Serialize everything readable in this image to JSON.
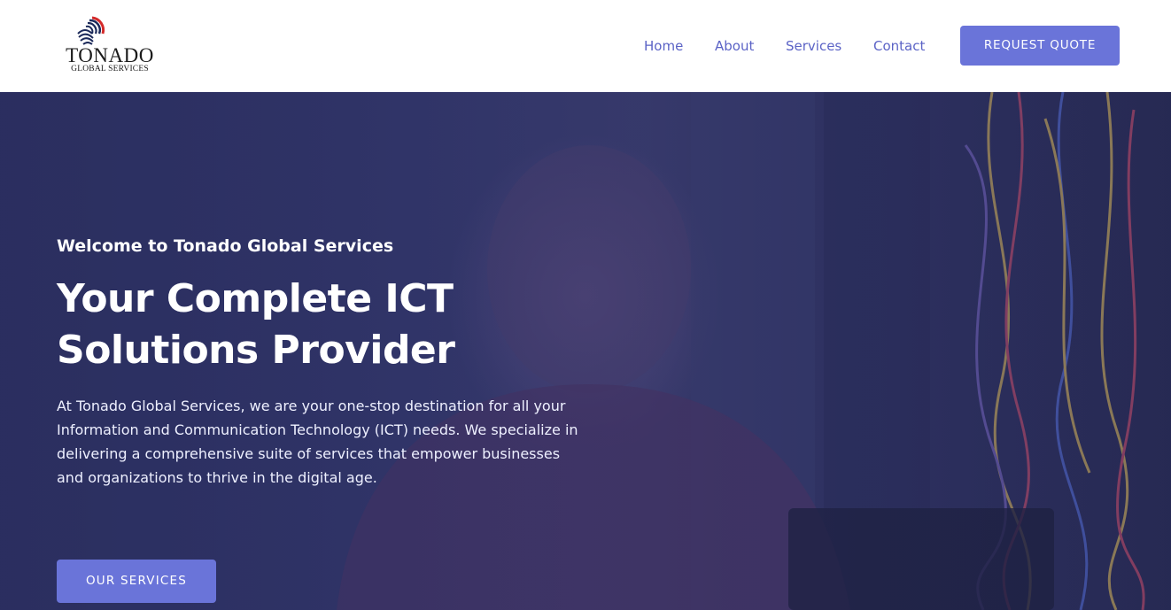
{
  "brand": {
    "name": "TONADO",
    "tagline": "GLOBAL SERVICES",
    "colors": {
      "accent": "#6a74d9",
      "nav_text": "#5b63c6",
      "logo_red": "#d42a2a",
      "logo_navy": "#1c2a5a"
    }
  },
  "nav": {
    "items": [
      {
        "label": "Home"
      },
      {
        "label": "About"
      },
      {
        "label": "Services"
      },
      {
        "label": "Contact"
      }
    ],
    "cta_label": "REQUEST QUOTE"
  },
  "hero": {
    "kicker": "Welcome to Tonado Global Services",
    "headline_line1": "Your Complete ICT",
    "headline_line2": "Solutions Provider",
    "description": "At Tonado Global Services, we are your one-stop destination for all your Information and Communication Technology (ICT) needs. We specialize in delivering a comprehensive suite of services that empower businesses and organizations to thrive in the digital age.",
    "button_label": "OUR SERVICES"
  },
  "icons": {
    "logo": "striped-globe-logo-icon"
  }
}
